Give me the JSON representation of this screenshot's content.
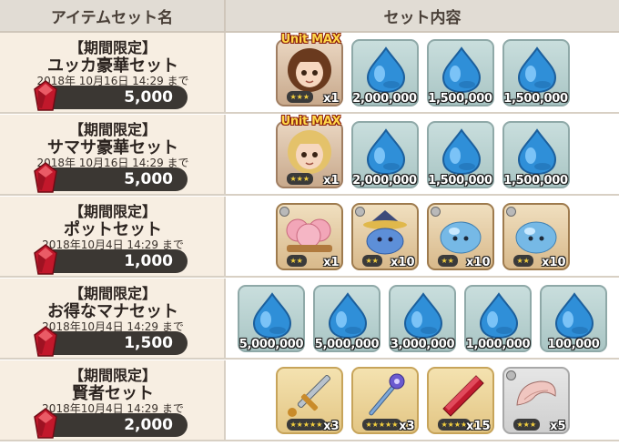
{
  "header": {
    "left": "アイテムセット名",
    "right": "セット内容"
  },
  "rows": [
    {
      "tag": "【期間限定】",
      "name": "ユッカ豪華セット",
      "date": "2018年 10月16日 14:29 まで",
      "price": "5,000",
      "items": [
        {
          "kind": "character",
          "icon": "yucca-character-icon",
          "badge": "Unit MAX",
          "stars": "★★★",
          "count": "x1"
        },
        {
          "kind": "mana",
          "icon": "mana-icon",
          "qty": "2,000,000"
        },
        {
          "kind": "mana",
          "icon": "mana-icon",
          "qty": "1,500,000"
        },
        {
          "kind": "mana",
          "icon": "mana-icon",
          "qty": "1,500,000"
        }
      ]
    },
    {
      "tag": "【期間限定】",
      "name": "サマサ豪華セット",
      "date": "2018年 10月16日 14:29 まで",
      "price": "5,000",
      "items": [
        {
          "kind": "character",
          "icon": "samasa-character-icon",
          "badge": "Unit MAX",
          "stars": "★★★",
          "count": "x1"
        },
        {
          "kind": "mana",
          "icon": "mana-icon",
          "qty": "2,000,000"
        },
        {
          "kind": "mana",
          "icon": "mana-icon",
          "qty": "1,500,000"
        },
        {
          "kind": "mana",
          "icon": "mana-icon",
          "qty": "1,500,000"
        }
      ]
    },
    {
      "tag": "【期間限定】",
      "name": "ポットセット",
      "date": "2018年10月4日 14:29 まで",
      "price": "1,000",
      "items": [
        {
          "kind": "pot",
          "icon": "pink-pot-icon",
          "stars": "★★",
          "count": "x1"
        },
        {
          "kind": "pot",
          "icon": "wizard-slime-icon",
          "stars": "★★",
          "count": "x10"
        },
        {
          "kind": "pot",
          "icon": "blue-slime-icon",
          "stars": "★★",
          "count": "x10"
        },
        {
          "kind": "pot",
          "icon": "blue-slime-icon",
          "stars": "★★",
          "count": "x10"
        }
      ]
    },
    {
      "tag": "【期間限定】",
      "name": "お得なマナセット",
      "date": "2018年10月4日 14:29 まで",
      "price": "1,500",
      "items": [
        {
          "kind": "mana",
          "icon": "mana-icon",
          "qty": "5,000,000"
        },
        {
          "kind": "mana",
          "icon": "mana-icon",
          "qty": "5,000,000"
        },
        {
          "kind": "mana",
          "icon": "mana-icon",
          "qty": "3,000,000"
        },
        {
          "kind": "mana",
          "icon": "mana-icon",
          "qty": "1,000,000"
        },
        {
          "kind": "mana",
          "icon": "mana-icon",
          "qty": "100,000"
        }
      ]
    },
    {
      "tag": "【期間限定】",
      "name": "賢者セット",
      "date": "2018年10月4日 14:29 まで",
      "price": "2,000",
      "items": [
        {
          "kind": "gold",
          "icon": "sword-icon",
          "stars": "★★★★★",
          "count": "x3"
        },
        {
          "kind": "gold",
          "icon": "staff-icon",
          "stars": "★★★★★",
          "count": "x3"
        },
        {
          "kind": "gold",
          "icon": "red-crystal-icon",
          "stars": "★★★★",
          "count": "x15"
        },
        {
          "kind": "gray",
          "icon": "horn-icon",
          "stars": "★★★",
          "count": "x5"
        }
      ]
    }
  ],
  "colors": {
    "header_bg": "#e1dcd4",
    "name_cell_bg": "#f7eee2",
    "price_bar": "#3b3733",
    "gem": "#c2182b"
  }
}
